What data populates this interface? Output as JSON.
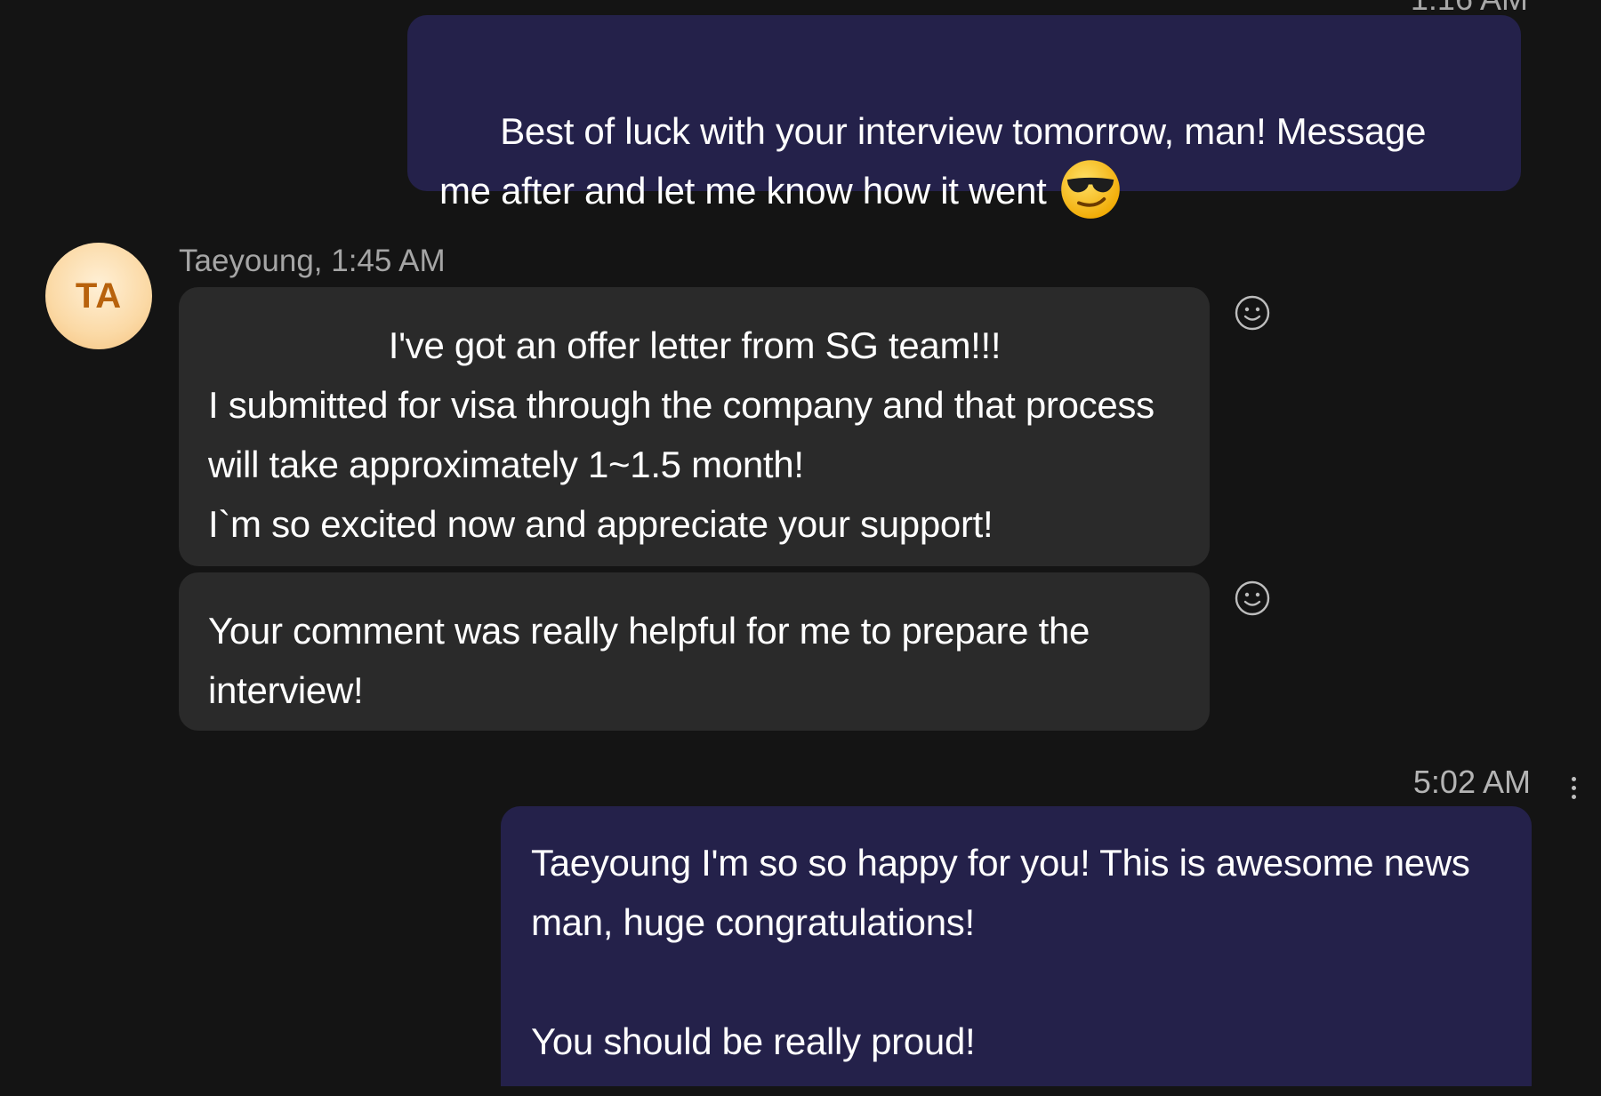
{
  "conversation": {
    "top_timestamp": "1:16 AM",
    "messages": [
      {
        "direction": "sent",
        "text": "Best of luck with your interview tomorrow, man! Message me after and let me know how it went",
        "emoji": "smiling-face-with-sunglasses"
      },
      {
        "direction": "received",
        "sender": "Taeyoung",
        "meta": "Taeyoung, 1:45 AM",
        "avatar_initials": "TA",
        "lines": [
          "I've got an offer letter from SG team!!!",
          "I submitted for visa through the company and that process will take approximately 1~1.5 month!",
          "I`m so excited now and appreciate your support!"
        ]
      },
      {
        "direction": "received",
        "text": "Your comment was really helpful for me to prepare the interview!"
      },
      {
        "direction": "sent",
        "timestamp": "5:02 AM",
        "lines": [
          "Taeyoung I'm so so happy for you! This is awesome news man, huge congratulations!",
          "",
          "You should be really proud!"
        ]
      }
    ]
  },
  "colors": {
    "background": "#141414",
    "sent_bubble": "#24214a",
    "received_bubble": "#2a2a2a",
    "avatar_text": "#b8620c"
  },
  "icons": {
    "reaction": "smiley-reaction-icon",
    "more": "more-options-icon",
    "emoji": "sunglasses-emoji-icon"
  }
}
